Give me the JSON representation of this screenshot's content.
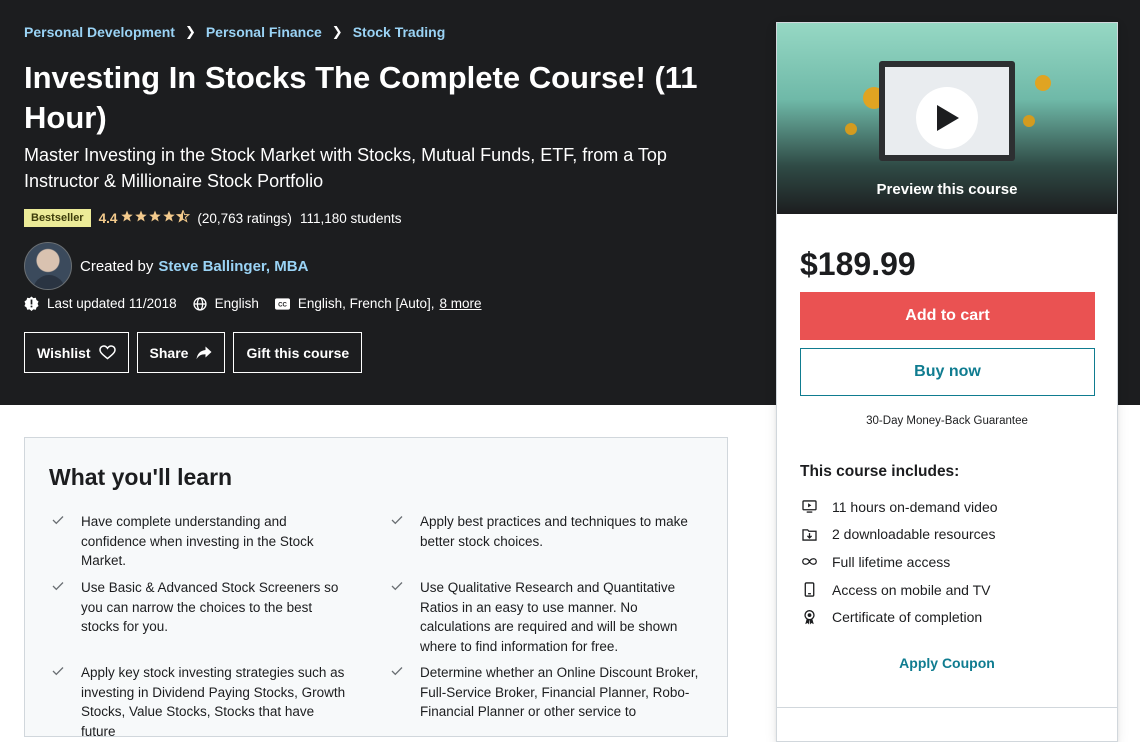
{
  "breadcrumb": [
    "Personal Development",
    "Personal Finance",
    "Stock Trading"
  ],
  "course": {
    "title": "Investing In Stocks The Complete Course! (11 Hour)",
    "subtitle": "Master Investing in the Stock Market with Stocks, Mutual Funds, ETF, from a Top Instructor & Millionaire Stock Portfolio",
    "badge": "Bestseller",
    "rating": "4.4",
    "stars_value": 4.4,
    "ratings_count": "(20,763 ratings)",
    "students": "111,180 students",
    "created_by_label": "Created by",
    "instructor": "Steve Ballinger, MBA",
    "last_updated": "Last updated 11/2018",
    "language": "English",
    "captions": "English, French [Auto],",
    "captions_more": "8 more"
  },
  "actions": {
    "wishlist": "Wishlist",
    "share": "Share",
    "gift": "Gift this course"
  },
  "sidebar": {
    "preview_label": "Preview this course",
    "price": "$189.99",
    "add_to_cart": "Add to cart",
    "buy_now": "Buy now",
    "guarantee": "30-Day Money-Back Guarantee",
    "includes_title": "This course includes:",
    "includes": [
      {
        "icon": "video-icon",
        "label": "11 hours on-demand video"
      },
      {
        "icon": "download-icon",
        "label": "2 downloadable resources"
      },
      {
        "icon": "infinity-icon",
        "label": "Full lifetime access"
      },
      {
        "icon": "mobile-icon",
        "label": "Access on mobile and TV"
      },
      {
        "icon": "certificate-icon",
        "label": "Certificate of completion"
      }
    ],
    "apply_coupon": "Apply Coupon"
  },
  "learn": {
    "title": "What you'll learn",
    "items": [
      "Have complete understanding and confidence when investing in the Stock Market.",
      "Apply best practices and techniques to make better stock choices.",
      "Use Basic & Advanced Stock Screeners so you can narrow the choices to the best stocks for you.",
      "Use Qualitative Research and Quantitative Ratios in an easy to use manner. No calculations are required and will be shown where to find information for free.",
      "Apply key stock investing strategies such as investing in Dividend Paying Stocks, Growth Stocks, Value Stocks, Stocks that have future",
      "Determine whether an Online Discount Broker, Full-Service Broker, Financial Planner, Robo-Financial Planner or other service to"
    ]
  },
  "colors": {
    "hero_bg": "#1c1d1f",
    "link": "#9ad3f5",
    "star": "#f3ca8c",
    "cart_button": "#ea5252",
    "accent": "#0f7c90"
  }
}
